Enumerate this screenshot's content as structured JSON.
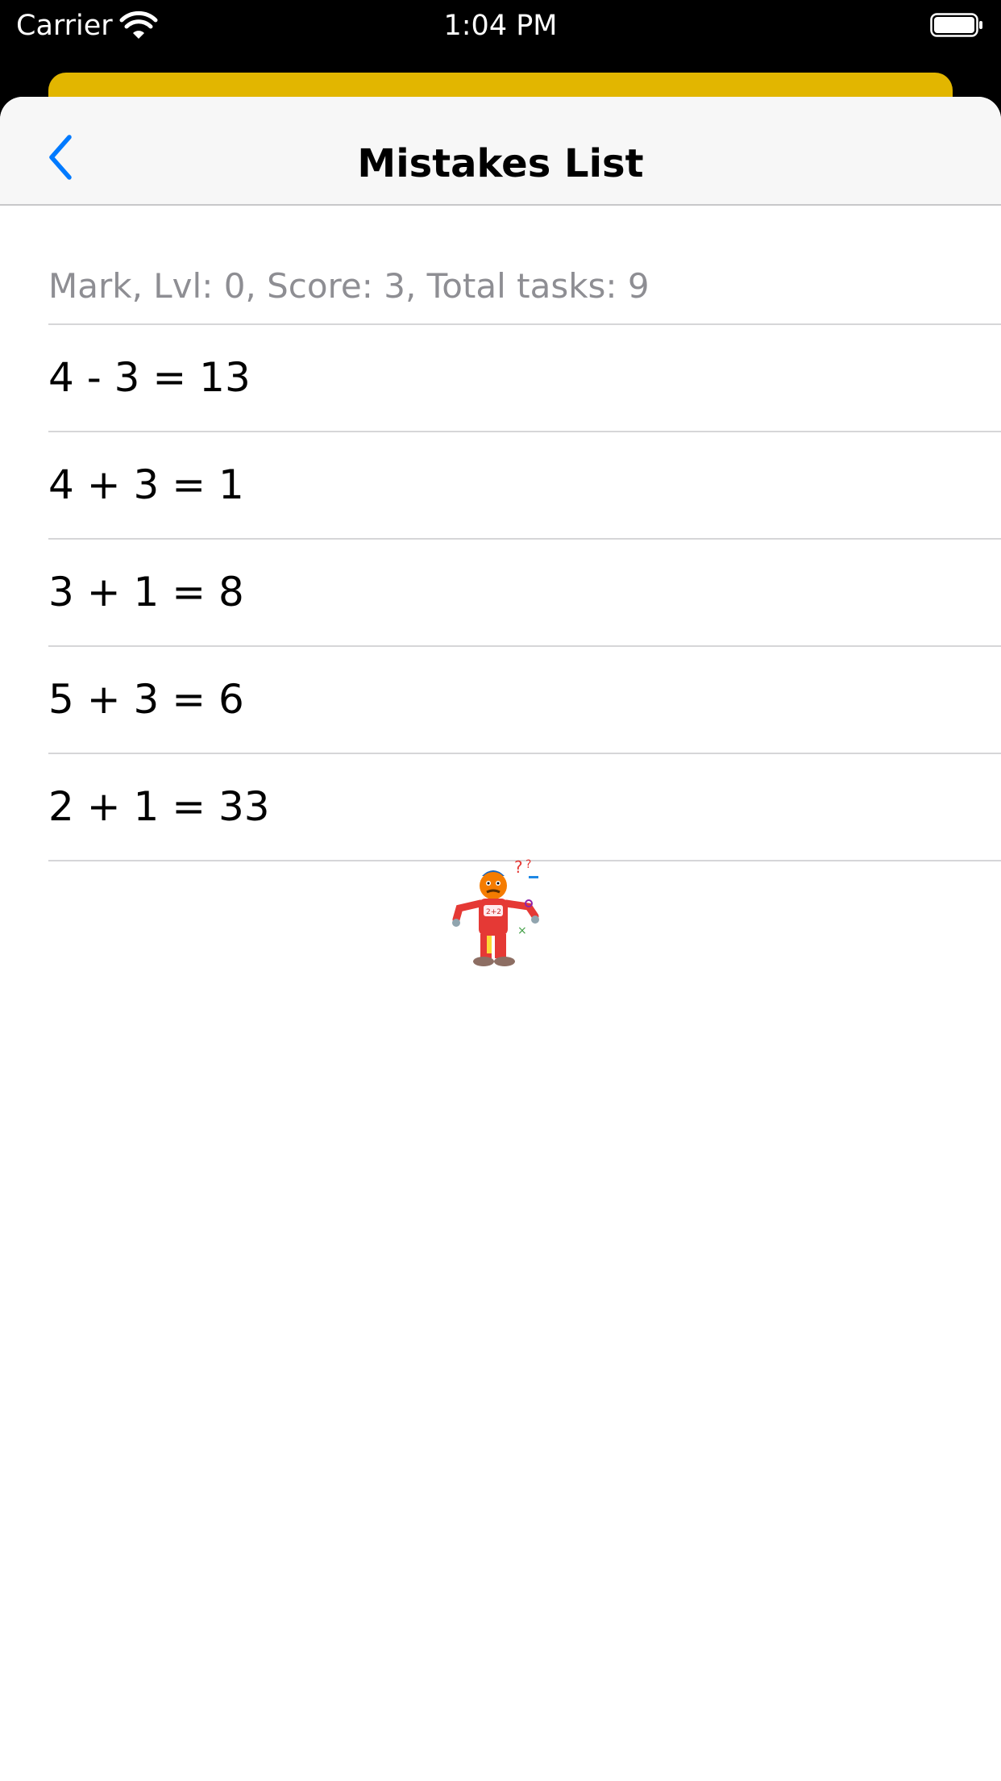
{
  "status_bar": {
    "carrier": "Carrier",
    "time": "1:04 PM"
  },
  "colors": {
    "accent": "#007aff",
    "underlying_card": "#e2b600",
    "secondary_text": "#8e8e93"
  },
  "nav": {
    "title": "Mistakes List",
    "back_icon": "chevron-left-icon"
  },
  "summary": "Mark, Lvl: 0, Score: 3, Total tasks: 9",
  "mistakes": [
    "4 - 3 = 13",
    "4 + 3 = 1",
    "3 + 1 = 8",
    "5 + 3 = 6",
    "2 + 1 = 33"
  ],
  "mascot_icon": "confused-mascot-icon"
}
